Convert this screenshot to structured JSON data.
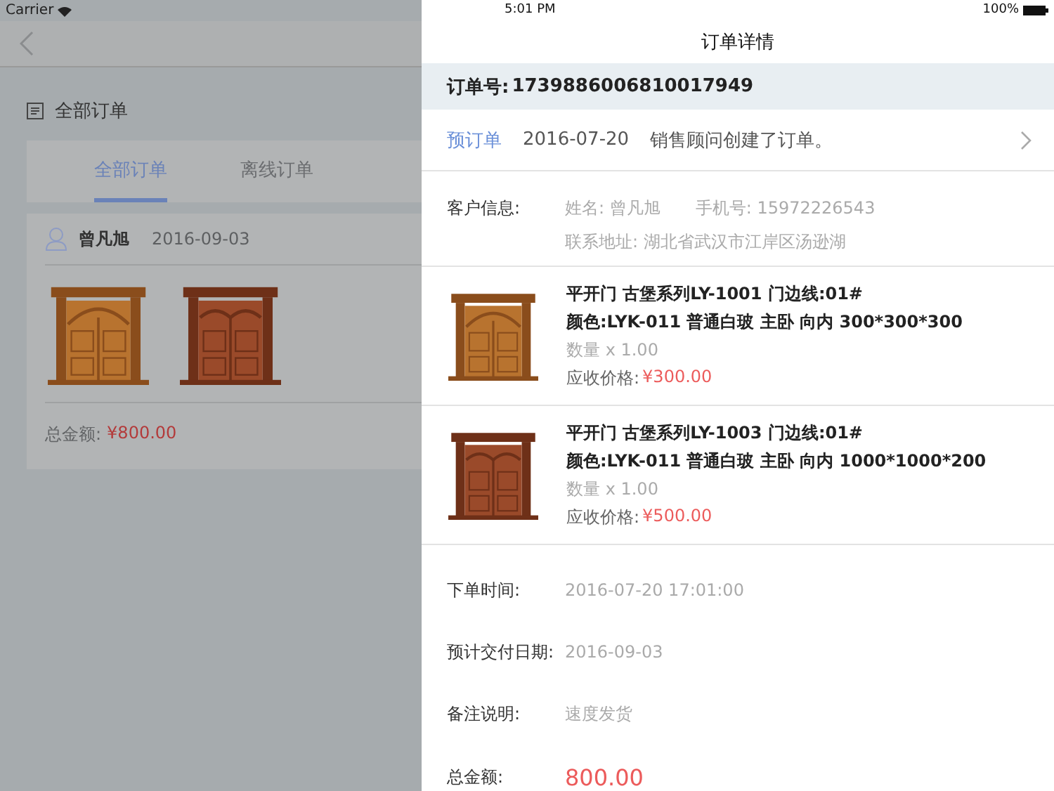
{
  "left_status_bar": {
    "carrier": "Carrier"
  },
  "left_panel": {
    "section_title": "全部订单",
    "tabs": [
      {
        "label": "全部订单",
        "selected": true
      },
      {
        "label": "离线订单",
        "selected": false
      }
    ],
    "order": {
      "customer": "曾凡旭",
      "date": "2016-09-03",
      "photos": [
        {
          "kind": "arched"
        },
        {
          "kind": "carved"
        }
      ],
      "total_label": "总金额:",
      "total": "¥800.00"
    }
  },
  "status_bar": {
    "time": "5:01 PM",
    "battery": "100%"
  },
  "title": "订单详情",
  "order_number": {
    "label": "订单号:",
    "value": "1739886006810017949"
  },
  "status_row": {
    "status": "预订单",
    "date": "2016-07-20",
    "message": "销售顾问创建了订单。"
  },
  "customer": {
    "label": "客户信息:",
    "name": "姓名: 曾凡旭",
    "phone": "手机号: 15972226543",
    "address": "联系地址: 湖北省武汉市江岸区汤逊湖"
  },
  "items": [
    {
      "kind": "arched",
      "line1": "平开门  古堡系列LY-1001  门边线:01#",
      "line2": "颜色:LYK-011  普通白玻  主卧  向内  300*300*300",
      "quantity": "数量 x 1.00",
      "price_label": "应收价格:",
      "price": "¥300.00"
    },
    {
      "kind": "carved",
      "line1": "平开门  古堡系列LY-1003  门边线:01#",
      "line2": "颜色:LYK-011  普通白玻  主卧  向内  1000*1000*200",
      "quantity": "数量 x 1.00",
      "price_label": "应收价格:",
      "price": "¥500.00"
    }
  ],
  "fields": [
    {
      "label": "下单时间:",
      "value": "2016-07-20 17:01:00"
    },
    {
      "label": "预计交付日期:",
      "value": "2016-09-03"
    },
    {
      "label": "备注说明:",
      "value": "速度发货"
    }
  ],
  "total": {
    "label": "总金额:",
    "value": "800.00"
  }
}
